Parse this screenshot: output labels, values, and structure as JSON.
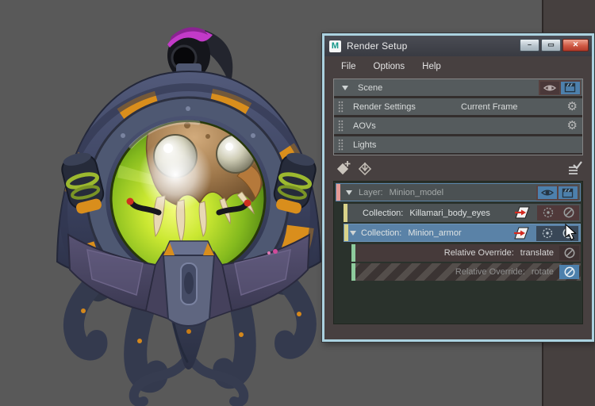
{
  "window": {
    "title": "Render Setup",
    "logo_letter": "M",
    "controls": {
      "minimize": "–",
      "maximize": "▭",
      "close": "✕"
    },
    "menu": {
      "file": "File",
      "options": "Options",
      "help": "Help"
    },
    "scene": {
      "header": "Scene",
      "render_settings": {
        "label": "Render Settings",
        "value": "Current Frame"
      },
      "aovs": {
        "label": "AOVs"
      },
      "lights": {
        "label": "Lights"
      }
    },
    "tree": {
      "layer": {
        "type": "Layer:",
        "name": "Minion_model"
      },
      "collection_1": {
        "type": "Collection:",
        "name": "Killamari_body_eyes"
      },
      "collection_2": {
        "type": "Collection:",
        "name": "Minion_armor",
        "state": "selected"
      },
      "override_1": {
        "type": "Relative Override:",
        "name": "translate"
      },
      "override_2": {
        "type": "Relative Override:",
        "name": "rotate",
        "state": "disabled"
      }
    }
  },
  "icons": {
    "gear": "⚙",
    "names": [
      "eye-icon",
      "renderable-clapperboard-icon",
      "isolate-select-icon",
      "model-filter-target-icon",
      "disable-icon",
      "create-layer-icon",
      "create-collection-icon",
      "sort-filter-icon",
      "drag-handle",
      "expand-triangle-icon"
    ]
  },
  "colors": {
    "viewport_gray": "#595959",
    "side_panel": "#46403f",
    "window_border_blue": "#abd2e0",
    "window_bg": "#474040",
    "row_gray": "#555b5d",
    "selected_row_blue": "#5a82a7",
    "accent_icon_blue": "#4d80ac",
    "layer_tag_salmon": "#e59a95",
    "collection_tag_yellow": "#d9d38a",
    "override_tag_green": "#8ecb9d",
    "close_button_red": "#c04a38",
    "maya_teal": "#14988a",
    "glass_green": "#9ccb27",
    "armor_orange": "#d98e1c"
  }
}
